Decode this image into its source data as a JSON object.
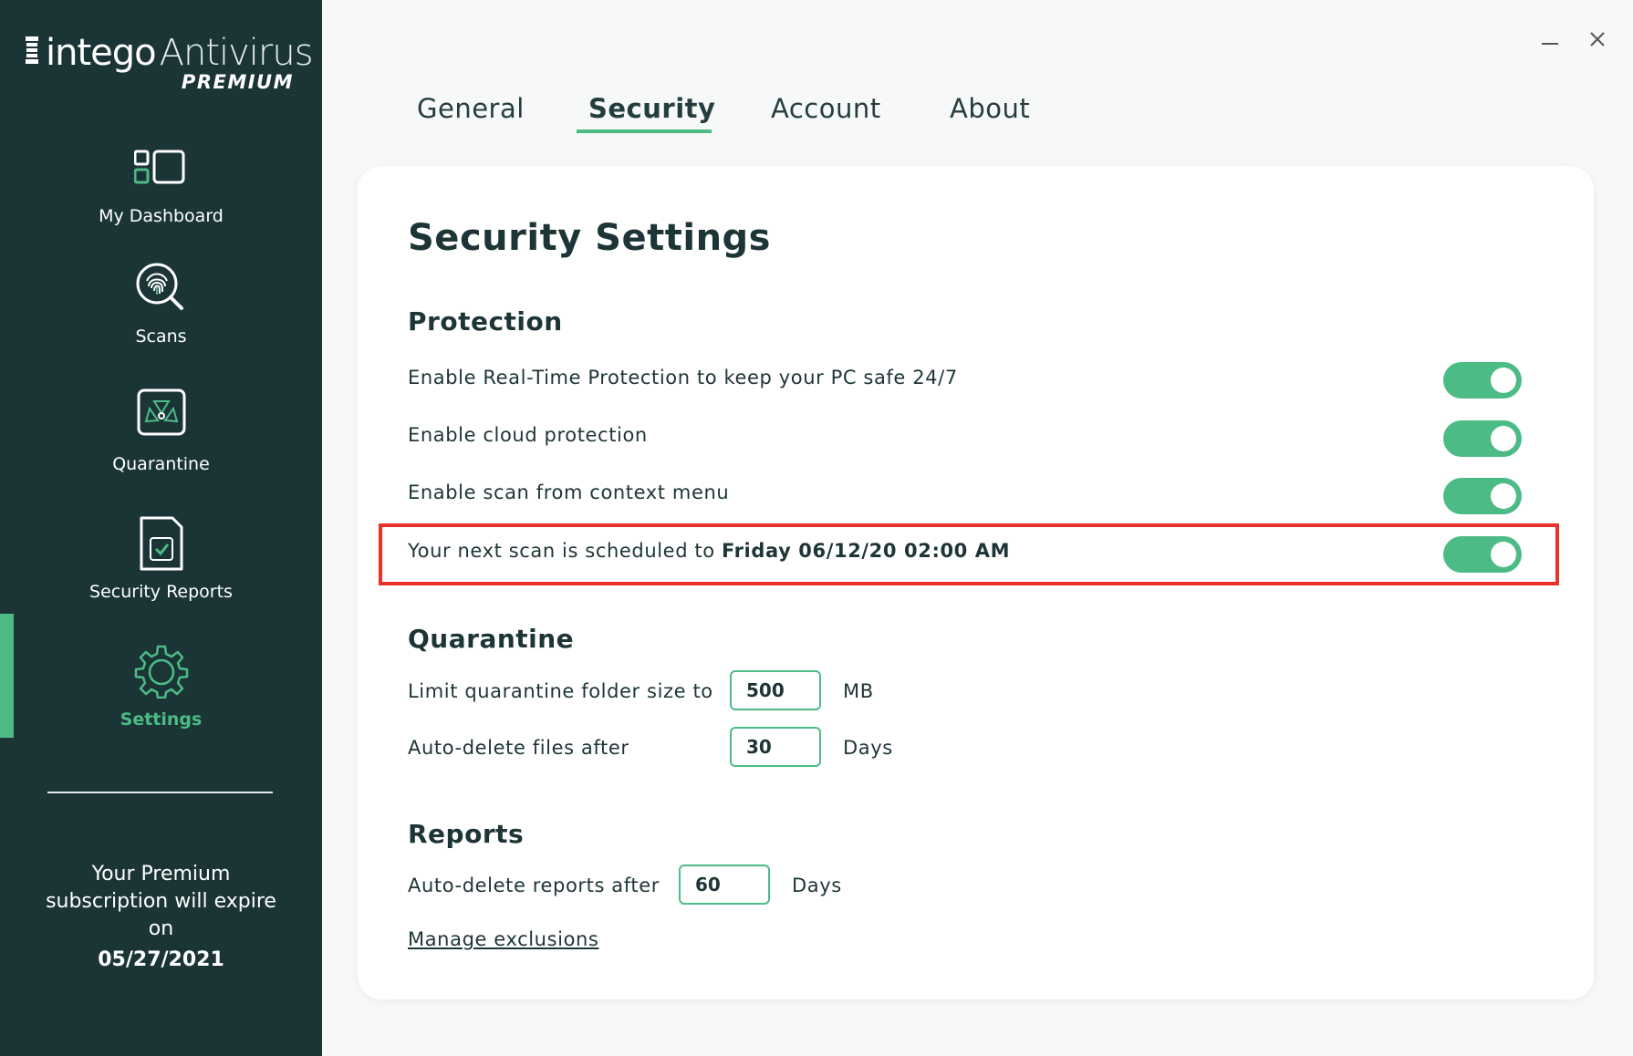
{
  "app": {
    "brand_primary": "intego",
    "brand_secondary": "Antivirus",
    "edition": "PREMIUM"
  },
  "colors": {
    "sidebar_bg": "#1b3537",
    "accent": "#4dbb85",
    "highlight": "#e8332a"
  },
  "sidebar": {
    "items": [
      {
        "label": "My Dashboard",
        "icon": "dashboard-icon"
      },
      {
        "label": "Scans",
        "icon": "fingerprint-search-icon"
      },
      {
        "label": "Quarantine",
        "icon": "biohazard-icon"
      },
      {
        "label": "Security Reports",
        "icon": "report-icon"
      },
      {
        "label": "Settings",
        "icon": "gear-icon",
        "active": true
      }
    ],
    "subscription_text": "Your Premium subscription will expire on",
    "subscription_date": "05/27/2021"
  },
  "window": {
    "minimize_icon": "minimize-icon",
    "close_icon": "close-icon"
  },
  "tabs": [
    {
      "label": "General"
    },
    {
      "label": "Security",
      "active": true
    },
    {
      "label": "Account"
    },
    {
      "label": "About"
    }
  ],
  "security": {
    "title": "Security Settings",
    "protection": {
      "title": "Protection",
      "options": [
        {
          "label": "Enable Real-Time Protection to keep your PC safe 24/7",
          "enabled": true
        },
        {
          "label": "Enable cloud protection",
          "enabled": true
        },
        {
          "label": "Enable scan from context menu",
          "enabled": true
        }
      ],
      "schedule": {
        "prefix": "Your next scan is scheduled to",
        "datetime": "Friday 06/12/20 02:00 AM",
        "enabled": true
      }
    },
    "quarantine": {
      "title": "Quarantine",
      "limit_label": "Limit quarantine folder size to",
      "limit_value": "500",
      "limit_unit": "MB",
      "autodelete_label": "Auto-delete files after",
      "autodelete_value": "30",
      "autodelete_unit": "Days"
    },
    "reports": {
      "title": "Reports",
      "autodelete_label": "Auto-delete reports after",
      "autodelete_value": "60",
      "autodelete_unit": "Days",
      "manage_link": "Manage exclusions"
    }
  }
}
